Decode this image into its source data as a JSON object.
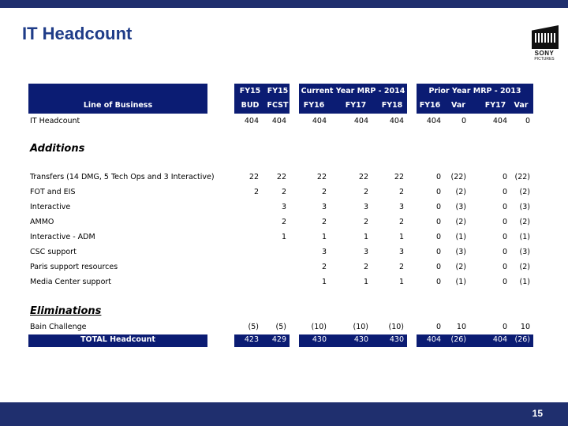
{
  "slide": {
    "title": "IT Headcount",
    "page_number": "15"
  },
  "logo": {
    "name": "SONY",
    "subtitle": "PICTURES"
  },
  "table": {
    "header_groups": [
      "Current Year MRP - 2014",
      "Prior Year MRP - 2013"
    ],
    "header_top": [
      "FY15",
      "FY15"
    ],
    "header_columns": [
      "Line of Business",
      "BUD",
      "FCST",
      "FY16",
      "FY17",
      "FY18",
      "FY16",
      "Var",
      "FY17",
      "Var"
    ],
    "it_headcount": {
      "label": "IT Headcount",
      "values": [
        "404",
        "404",
        "404",
        "404",
        "404",
        "404",
        "0",
        "404",
        "0"
      ]
    },
    "additions_heading": "Additions",
    "additions": [
      {
        "label": "Transfers (14 DMG, 5 Tech Ops and 3 Interactive)",
        "values": [
          "22",
          "22",
          "22",
          "22",
          "22",
          "0",
          "(22)",
          "0",
          "(22)"
        ]
      },
      {
        "label": "FOT and EIS",
        "values": [
          "2",
          "2",
          "2",
          "2",
          "2",
          "0",
          "(2)",
          "0",
          "(2)"
        ]
      },
      {
        "label": "Interactive",
        "values": [
          "",
          "3",
          "3",
          "3",
          "3",
          "0",
          "(3)",
          "0",
          "(3)"
        ]
      },
      {
        "label": "AMMO",
        "values": [
          "",
          "2",
          "2",
          "2",
          "2",
          "0",
          "(2)",
          "0",
          "(2)"
        ]
      },
      {
        "label": "Interactive - ADM",
        "values": [
          "",
          "1",
          "1",
          "1",
          "1",
          "0",
          "(1)",
          "0",
          "(1)"
        ]
      },
      {
        "label": "CSC support",
        "values": [
          "",
          "",
          "3",
          "3",
          "3",
          "0",
          "(3)",
          "0",
          "(3)"
        ]
      },
      {
        "label": "Paris support resources",
        "values": [
          "",
          "",
          "2",
          "2",
          "2",
          "0",
          "(2)",
          "0",
          "(2)"
        ]
      },
      {
        "label": "Media Center support",
        "values": [
          "",
          "",
          "1",
          "1",
          "1",
          "0",
          "(1)",
          "0",
          "(1)"
        ]
      }
    ],
    "eliminations_heading": "Eliminations",
    "eliminations": [
      {
        "label": "Bain Challenge",
        "values": [
          "(5)",
          "(5)",
          "(10)",
          "(10)",
          "(10)",
          "0",
          "10",
          "0",
          "10"
        ]
      }
    ],
    "total": {
      "label": "TOTAL Headcount",
      "values": [
        "423",
        "429",
        "430",
        "430",
        "430",
        "404",
        "(26)",
        "404",
        "(26)"
      ]
    }
  }
}
